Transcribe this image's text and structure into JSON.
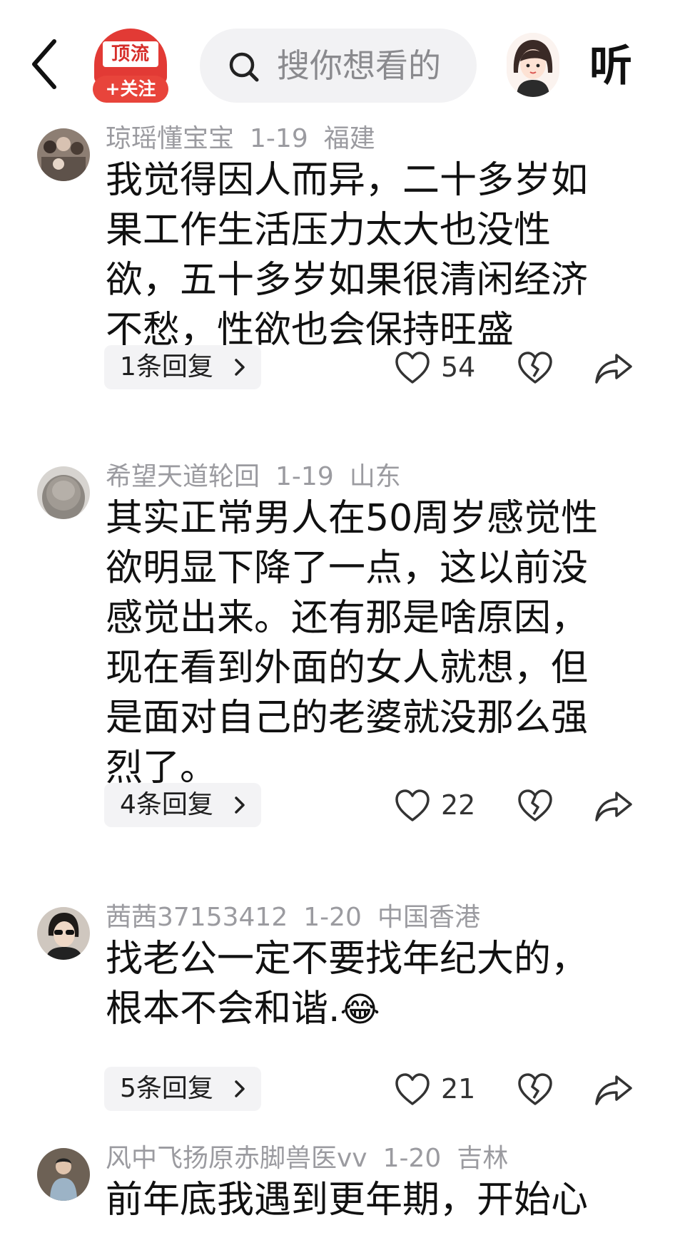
{
  "header": {
    "channel_logo_text": "顶流",
    "follow_label": "+关注",
    "search_placeholder": "搜你想看的",
    "listen_label": "听"
  },
  "comments": [
    {
      "user": "琼瑶懂宝宝",
      "date": "1-19",
      "location": "福建",
      "text": "我觉得因人而异，二十多岁如\n果工作生活压力太大也没性\n欲，五十多岁如果很清闲经济\n不愁，性欲也会保持旺盛",
      "replies_label": "1条回复",
      "likes": "54"
    },
    {
      "user": "希望天道轮回",
      "date": "1-19",
      "location": "山东",
      "text": "其实正常男人在50周岁感觉性\n欲明显下降了一点，这以前没\n感觉出来。还有那是啥原因，\n现在看到外面的女人就想，但\n是面对自己的老婆就没那么强\n烈了。",
      "replies_label": "4条回复",
      "likes": "22"
    },
    {
      "user": "茜茜37153412",
      "date": "1-20",
      "location": "中国香港",
      "text": "找老公一定不要找年纪大的，\n根本不会和谐.",
      "emoji": "😂",
      "replies_label": "5条回复",
      "likes": "21"
    },
    {
      "user": "风中飞扬原赤脚兽医vv",
      "date": "1-20",
      "location": "吉林",
      "text": "前年底我遇到更年期，开始心"
    }
  ],
  "icons": {
    "back": "chevron-left-icon",
    "search": "search-icon",
    "like": "heart-outline-icon",
    "dislike": "broken-heart-icon",
    "share": "share-arrow-icon",
    "reply_more": "chevron-right-icon"
  },
  "colors": {
    "brand_red": "#e23a35",
    "meta_gray": "#9b9ba0",
    "reply_bg": "#f3f3f5"
  }
}
